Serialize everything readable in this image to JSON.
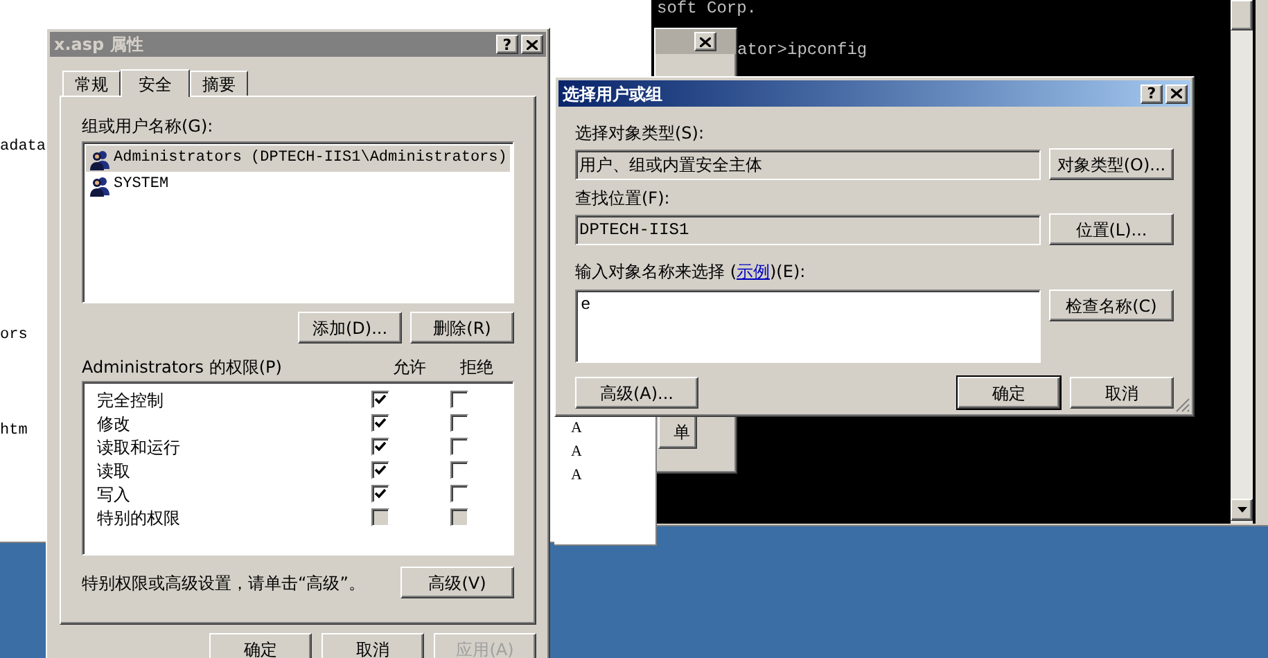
{
  "explorer": {
    "side_texts": [
      "adata",
      "ors",
      "htm"
    ],
    "popup_items": [
      "A",
      "A",
      "A"
    ]
  },
  "console": {
    "lines": [
      "soft Corp.",
      "ator>ipconfig"
    ]
  },
  "background_dialog": {
    "button": "单"
  },
  "properties": {
    "title": "x.asp 属性",
    "help": "?",
    "tabs": [
      {
        "label": "常规",
        "selected": false
      },
      {
        "label": "安全",
        "selected": true
      },
      {
        "label": "摘要",
        "selected": false
      }
    ],
    "users_label": "组或用户名称(G):",
    "users": [
      {
        "name": "Administrators (DPTECH-IIS1\\Administrators)",
        "selected": true
      },
      {
        "name": "SYSTEM",
        "selected": false
      }
    ],
    "user_buttons": [
      "添加(D)...",
      "删除(R)"
    ],
    "permissions_label": "Administrators 的权限(P)",
    "allow_header": "允许",
    "deny_header": "拒绝",
    "permissions": [
      {
        "name": "完全控制",
        "allow": true,
        "deny": false,
        "disabled": false
      },
      {
        "name": "修改",
        "allow": true,
        "deny": false,
        "disabled": false
      },
      {
        "name": "读取和运行",
        "allow": true,
        "deny": false,
        "disabled": false
      },
      {
        "name": "读取",
        "allow": true,
        "deny": false,
        "disabled": false
      },
      {
        "name": "写入",
        "allow": true,
        "deny": false,
        "disabled": false
      },
      {
        "name": "特别的权限",
        "allow": false,
        "deny": false,
        "disabled": true
      }
    ],
    "advanced_note": "特别权限或高级设置，请单击“高级”。",
    "advanced_button": "高级(V)",
    "buttons": [
      {
        "label": "确定",
        "disabled": false
      },
      {
        "label": "取消",
        "disabled": false
      },
      {
        "label": "应用(A)",
        "disabled": true
      }
    ]
  },
  "select_dialog": {
    "title": "选择用户或组",
    "help": "?",
    "object_type_label": "选择对象类型(S):",
    "object_type_value": "用户、组或内置安全主体",
    "object_type_button": "对象类型(O)...",
    "location_label": "查找位置(F):",
    "location_value": "DPTECH-IIS1",
    "location_button": "位置(L)...",
    "names_label_before": "输入对象名称来选择 (",
    "names_link": "示例",
    "names_label_after": ")(E):",
    "names_value": "e",
    "check_button": "检查名称(C)",
    "advanced_button": "高级(A)...",
    "ok_button": "确定",
    "cancel_button": "取消"
  }
}
